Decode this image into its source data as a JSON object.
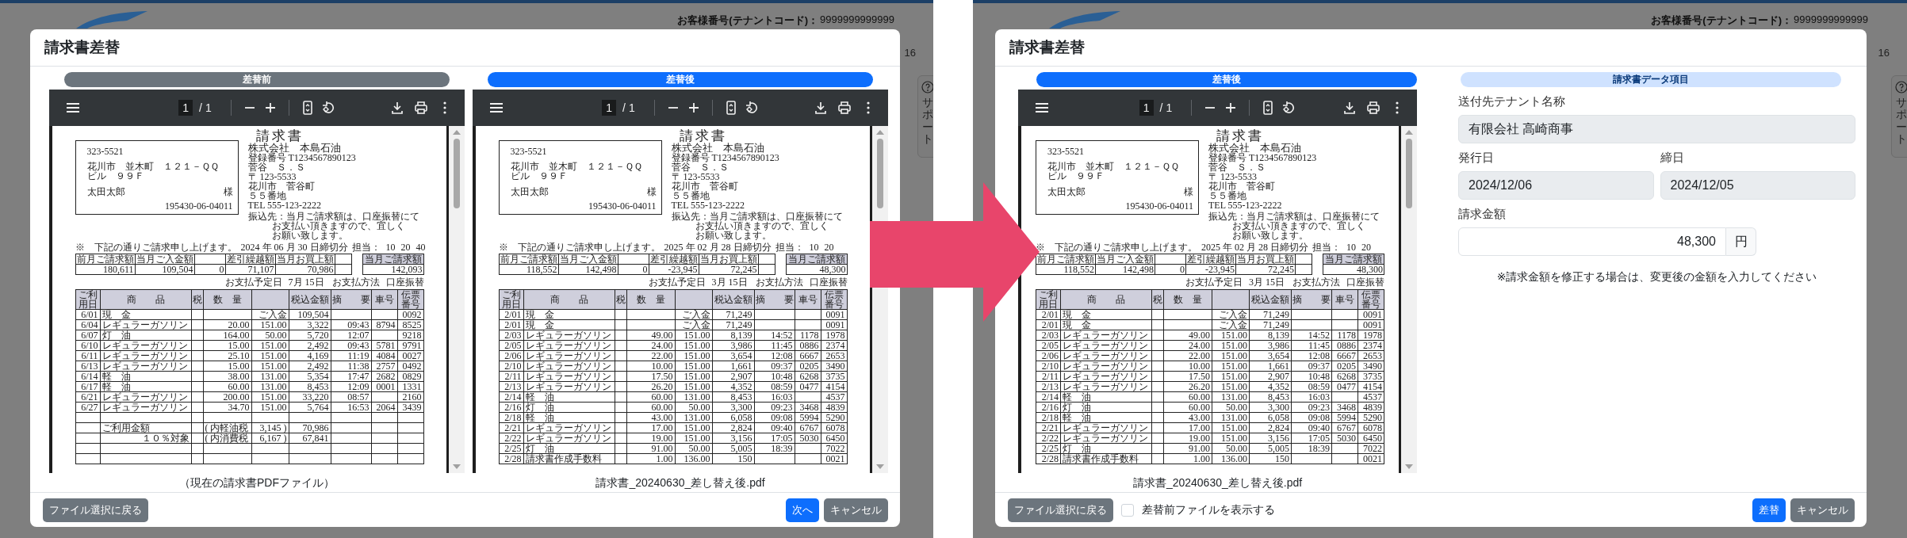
{
  "screens": [
    {
      "backdrop": {
        "customer_label": "お客様番号(テナントコード)：",
        "customer_number": "9999999999999",
        "partial_text": "16",
        "support_tab": "サポート"
      },
      "dialog": {
        "title": "請求書差替",
        "viewers": [
          {
            "heading": "差替前",
            "kind": "before",
            "page": "1",
            "page_total": "/ 1",
            "caption": "（現在の請求書PDFファイル）",
            "document": {
              "address": {
                "postal": "323-5521",
                "lines": [
                  "花川市　並木町　１２１－ＱＱ",
                  "ビル　９９Ｆ"
                ],
                "recipient": "太田太郎",
                "honorific": "様",
                "code": "195430-06-04011"
              },
              "title": "請求書",
              "issuer": {
                "name": "株式会社　本島石油",
                "registration_label": "登録番号",
                "registration": "T1234567890123",
                "lines": [
                  "菅谷　Ｓ．Ｓ",
                  "〒 123-5533",
                  "花川市　菅谷町",
                  "５５番地",
                  "TEL 555-123-2222"
                ]
              },
              "remittance_note": [
                "振込先：当月ご請求額は、口座振替にて",
                "お支払い頂きますので、宜しく",
                "お願い致します。"
              ],
              "lead": "※　下記の通りご請求申し上げます。",
              "closing": "2024 年 06 月 30 日締切分",
              "staff_label": "担当：",
              "staff": [
                "10",
                "20",
                "40"
              ],
              "summary": [
                {
                  "heading": "前月ご請求額",
                  "value": "180,611"
                },
                {
                  "heading": "当月ご入金額",
                  "value": "109,504"
                },
                {
                  "value": "0"
                },
                {
                  "heading": "差引繰越額",
                  "value": "71,107"
                },
                {
                  "heading": "当月お買上額",
                  "value": "70,986"
                }
              ],
              "total": {
                "heading": "当月ご請求額",
                "value": "142,093"
              },
              "payment": {
                "due_label": "お支払予定日",
                "due": "7月 15日",
                "method_label": "お支払方法",
                "method": "口座振替"
              },
              "columns": {
                "date": "ご利用日",
                "product": "商　　品",
                "tax": "税",
                "quantity": "数　量",
                "amount": "税込金額",
                "memo": "摘　　要",
                "car": "車号",
                "slip": "伝票番号"
              },
              "rows": [
                {
                  "kind": "entry",
                  "date": "6/01",
                  "product": "現　金",
                  "price": "ご入金",
                  "amount": "109,504",
                  "slip": "0092"
                },
                {
                  "kind": "entry",
                  "date": "6/04",
                  "product": "レギュラーガソリン",
                  "quantity": "20.00",
                  "price": "151.00",
                  "amount": "3,322",
                  "memo": "09:43",
                  "car": "8794",
                  "slip": "8525"
                },
                {
                  "kind": "entry",
                  "date": "6/07",
                  "product": "灯　油",
                  "quantity": "164.00",
                  "price": "50.00",
                  "amount": "5,720",
                  "memo": "12:07",
                  "slip": "9218"
                },
                {
                  "kind": "entry",
                  "date": "6/10",
                  "product": "レギュラーガソリン",
                  "quantity": "15.00",
                  "price": "151.00",
                  "amount": "2,492",
                  "memo": "09:43",
                  "car": "5781",
                  "slip": "9791"
                },
                {
                  "kind": "entry",
                  "date": "6/11",
                  "product": "レギュラーガソリン",
                  "quantity": "25.10",
                  "price": "151.00",
                  "amount": "4,169",
                  "memo": "11:19",
                  "car": "4084",
                  "slip": "0027"
                },
                {
                  "kind": "entry",
                  "date": "6/13",
                  "product": "レギュラーガソリン",
                  "quantity": "15.00",
                  "price": "151.00",
                  "amount": "2,492",
                  "memo": "11:38",
                  "car": "2757",
                  "slip": "0492"
                },
                {
                  "kind": "entry",
                  "date": "6/14",
                  "product": "軽　油",
                  "quantity": "38.00",
                  "price": "131.00",
                  "amount": "5,354",
                  "memo": "17:47",
                  "car": "2682",
                  "slip": "0829"
                },
                {
                  "kind": "entry",
                  "date": "6/17",
                  "product": "軽　油",
                  "quantity": "60.00",
                  "price": "131.00",
                  "amount": "8,453",
                  "memo": "12:09",
                  "car": "0001",
                  "slip": "1331"
                },
                {
                  "kind": "entry",
                  "date": "6/21",
                  "product": "レギュラーガソリン",
                  "quantity": "200.00",
                  "price": "151.00",
                  "amount": "33,220",
                  "memo": "08:57",
                  "slip": "2160"
                },
                {
                  "kind": "entry",
                  "date": "6/27",
                  "product": "レギュラーガソリン",
                  "quantity": "34.70",
                  "price": "151.00",
                  "amount": "5,764",
                  "memo": "16:53",
                  "car": "2064",
                  "slip": "3439"
                },
                {
                  "kind": "blank"
                },
                {
                  "kind": "usage-total",
                  "product": "ご利用金額",
                  "quantity": "( 内軽油税",
                  "price": "3,145 )",
                  "amount": "70,986"
                },
                {
                  "kind": "tax-band",
                  "product": "１０％対象",
                  "quantity": "( 内消費税",
                  "price": "6,167 )",
                  "amount": "67,841"
                },
                {
                  "kind": "blank"
                },
                {
                  "kind": "blank"
                }
              ]
            }
          },
          {
            "heading": "差替後",
            "kind": "after",
            "page": "1",
            "page_total": "/ 1",
            "caption": "請求書_20240630_差し替え後.pdf",
            "document": {
              "address": {
                "postal": "323-5521",
                "lines": [
                  "花川市　並木町　１２１－ＱＱ",
                  "ビル　９９Ｆ"
                ],
                "recipient": "太田太郎",
                "honorific": "様",
                "code": "195430-06-04011"
              },
              "title": "請求書",
              "issuer": {
                "name": "株式会社　本島石油",
                "registration_label": "登録番号",
                "registration": "T1234567890123",
                "lines": [
                  "菅谷　Ｓ．Ｓ",
                  "〒 123-5533",
                  "花川市　菅谷町",
                  "５５番地",
                  "TEL 555-123-2222"
                ]
              },
              "remittance_note": [
                "振込先：当月ご請求額は、口座振替にて",
                "お支払い頂きますので、宜しく",
                "お願い致します。"
              ],
              "lead": "※　下記の通りご請求申し上げます。",
              "closing": "2025 年 02 月 28 日締切分",
              "staff_label": "担当：",
              "staff": [
                "10",
                "20"
              ],
              "summary": [
                {
                  "heading": "前月ご請求額",
                  "value": "118,552"
                },
                {
                  "heading": "当月ご入金額",
                  "value": "142,498"
                },
                {
                  "value": "0"
                },
                {
                  "heading": "差引繰越額",
                  "value": "-23,945"
                },
                {
                  "heading": "当月お買上額",
                  "value": "72,245"
                }
              ],
              "total": {
                "heading": "当月ご請求額",
                "value": "48,300"
              },
              "payment": {
                "due_label": "お支払予定日",
                "due": "3月 15日",
                "method_label": "お支払方法",
                "method": "口座振替"
              },
              "columns": {
                "date": "ご利用日",
                "product": "商　　品",
                "tax": "税",
                "quantity": "数　量",
                "amount": "税込金額",
                "memo": "摘　　要",
                "car": "車号",
                "slip": "伝票番号"
              },
              "rows": [
                {
                  "kind": "entry",
                  "date": "2/01",
                  "product": "現　金",
                  "price": "ご入金",
                  "amount": "71,249",
                  "slip": "0091"
                },
                {
                  "kind": "entry",
                  "date": "2/01",
                  "product": "現　金",
                  "price": "ご入金",
                  "amount": "71,249",
                  "slip": "0091"
                },
                {
                  "kind": "entry",
                  "date": "2/03",
                  "product": "レギュラーガソリン",
                  "quantity": "49.00",
                  "price": "151.00",
                  "amount": "8,139",
                  "memo": "14:52",
                  "car": "1178",
                  "slip": "1978"
                },
                {
                  "kind": "entry",
                  "date": "2/05",
                  "product": "レギュラーガソリン",
                  "quantity": "24.00",
                  "price": "151.00",
                  "amount": "3,986",
                  "memo": "11:45",
                  "car": "0886",
                  "slip": "2374"
                },
                {
                  "kind": "entry",
                  "date": "2/06",
                  "product": "レギュラーガソリン",
                  "quantity": "22.00",
                  "price": "151.00",
                  "amount": "3,654",
                  "memo": "12:08",
                  "car": "6667",
                  "slip": "2653"
                },
                {
                  "kind": "entry",
                  "date": "2/10",
                  "product": "レギュラーガソリン",
                  "quantity": "10.00",
                  "price": "151.00",
                  "amount": "1,661",
                  "memo": "09:37",
                  "car": "0205",
                  "slip": "3490"
                },
                {
                  "kind": "entry",
                  "date": "2/11",
                  "product": "レギュラーガソリン",
                  "quantity": "17.50",
                  "price": "151.00",
                  "amount": "2,907",
                  "memo": "10:48",
                  "car": "6268",
                  "slip": "3735"
                },
                {
                  "kind": "entry",
                  "date": "2/13",
                  "product": "レギュラーガソリン",
                  "quantity": "26.20",
                  "price": "151.00",
                  "amount": "4,352",
                  "memo": "08:59",
                  "car": "0477",
                  "slip": "4154"
                },
                {
                  "kind": "entry",
                  "date": "2/14",
                  "product": "軽　油",
                  "quantity": "60.00",
                  "price": "131.00",
                  "amount": "8,453",
                  "memo": "16:03",
                  "slip": "4537"
                },
                {
                  "kind": "entry",
                  "date": "2/16",
                  "product": "灯　油",
                  "quantity": "60.00",
                  "price": "50.00",
                  "amount": "3,300",
                  "memo": "09:23",
                  "car": "3468",
                  "slip": "4839"
                },
                {
                  "kind": "entry",
                  "date": "2/18",
                  "product": "軽　油",
                  "quantity": "43.00",
                  "price": "131.00",
                  "amount": "6,058",
                  "memo": "09:08",
                  "car": "5994",
                  "slip": "5290"
                },
                {
                  "kind": "entry",
                  "date": "2/21",
                  "product": "レギュラーガソリン",
                  "quantity": "17.00",
                  "price": "151.00",
                  "amount": "2,824",
                  "memo": "09:40",
                  "car": "6767",
                  "slip": "6078"
                },
                {
                  "kind": "entry",
                  "date": "2/22",
                  "product": "レギュラーガソリン",
                  "quantity": "19.00",
                  "price": "151.00",
                  "amount": "3,156",
                  "memo": "17:05",
                  "car": "5030",
                  "slip": "6450"
                },
                {
                  "kind": "entry",
                  "date": "2/25",
                  "product": "灯　油",
                  "quantity": "91.00",
                  "price": "50.00",
                  "amount": "5,005",
                  "memo": "18:39",
                  "slip": "7022"
                },
                {
                  "kind": "entry",
                  "date": "2/28",
                  "product": "請求書作成手数料",
                  "quantity": "1.00",
                  "price": "136.00",
                  "amount": "150",
                  "slip": "0021"
                }
              ]
            }
          }
        ],
        "footer": {
          "back": "ファイル選択に戻る",
          "buttons": [
            {
              "label": "次へ",
              "kind": "primary"
            },
            {
              "label": "キャンセル",
              "kind": "secondary"
            }
          ]
        }
      }
    },
    {
      "backdrop": {
        "customer_label": "お客様番号(テナントコード)：",
        "customer_number": "9999999999999",
        "partial_text": "16",
        "support_tab": "サポート"
      },
      "dialog": {
        "title": "請求書差替",
        "viewers": [
          {
            "heading": "差替後",
            "kind": "after",
            "page": "1",
            "page_total": "/ 1",
            "caption": "請求書_20240630_差し替え後.pdf",
            "document": {
              "address": {
                "postal": "323-5521",
                "lines": [
                  "花川市　並木町　１２１－ＱＱ",
                  "ビル　９９Ｆ"
                ],
                "recipient": "太田太郎",
                "honorific": "様",
                "code": "195430-06-04011"
              },
              "title": "請求書",
              "issuer": {
                "name": "株式会社　本島石油",
                "registration_label": "登録番号",
                "registration": "T1234567890123",
                "lines": [
                  "菅谷　Ｓ．Ｓ",
                  "〒 123-5533",
                  "花川市　菅谷町",
                  "５５番地",
                  "TEL 555-123-2222"
                ]
              },
              "remittance_note": [
                "振込先：当月ご請求額は、口座振替にて",
                "お支払い頂きますので、宜しく",
                "お願い致します。"
              ],
              "lead": "※　下記の通りご請求申し上げます。",
              "closing": "2025 年 02 月 28 日締切分",
              "staff_label": "担当：",
              "staff": [
                "10",
                "20"
              ],
              "summary": [
                {
                  "heading": "前月ご請求額",
                  "value": "118,552"
                },
                {
                  "heading": "当月ご入金額",
                  "value": "142,498"
                },
                {
                  "value": "0"
                },
                {
                  "heading": "差引繰越額",
                  "value": "-23,945"
                },
                {
                  "heading": "当月お買上額",
                  "value": "72,245"
                }
              ],
              "total": {
                "heading": "当月ご請求額",
                "value": "48,300"
              },
              "payment": {
                "due_label": "お支払予定日",
                "due": "3月 15日",
                "method_label": "お支払方法",
                "method": "口座振替"
              },
              "columns": {
                "date": "ご利用日",
                "product": "商　　品",
                "tax": "税",
                "quantity": "数　量",
                "amount": "税込金額",
                "memo": "摘　　要",
                "car": "車号",
                "slip": "伝票番号"
              },
              "rows": [
                {
                  "kind": "entry",
                  "date": "2/01",
                  "product": "現　金",
                  "price": "ご入金",
                  "amount": "71,249",
                  "slip": "0091"
                },
                {
                  "kind": "entry",
                  "date": "2/01",
                  "product": "現　金",
                  "price": "ご入金",
                  "amount": "71,249",
                  "slip": "0091"
                },
                {
                  "kind": "entry",
                  "date": "2/03",
                  "product": "レギュラーガソリン",
                  "quantity": "49.00",
                  "price": "151.00",
                  "amount": "8,139",
                  "memo": "14:52",
                  "car": "1178",
                  "slip": "1978"
                },
                {
                  "kind": "entry",
                  "date": "2/05",
                  "product": "レギュラーガソリン",
                  "quantity": "24.00",
                  "price": "151.00",
                  "amount": "3,986",
                  "memo": "11:45",
                  "car": "0886",
                  "slip": "2374"
                },
                {
                  "kind": "entry",
                  "date": "2/06",
                  "product": "レギュラーガソリン",
                  "quantity": "22.00",
                  "price": "151.00",
                  "amount": "3,654",
                  "memo": "12:08",
                  "car": "6667",
                  "slip": "2653"
                },
                {
                  "kind": "entry",
                  "date": "2/10",
                  "product": "レギュラーガソリン",
                  "quantity": "10.00",
                  "price": "151.00",
                  "amount": "1,661",
                  "memo": "09:37",
                  "car": "0205",
                  "slip": "3490"
                },
                {
                  "kind": "entry",
                  "date": "2/11",
                  "product": "レギュラーガソリン",
                  "quantity": "17.50",
                  "price": "151.00",
                  "amount": "2,907",
                  "memo": "10:48",
                  "car": "6268",
                  "slip": "3735"
                },
                {
                  "kind": "entry",
                  "date": "2/13",
                  "product": "レギュラーガソリン",
                  "quantity": "26.20",
                  "price": "151.00",
                  "amount": "4,352",
                  "memo": "08:59",
                  "car": "0477",
                  "slip": "4154"
                },
                {
                  "kind": "entry",
                  "date": "2/14",
                  "product": "軽　油",
                  "quantity": "60.00",
                  "price": "131.00",
                  "amount": "8,453",
                  "memo": "16:03",
                  "slip": "4537"
                },
                {
                  "kind": "entry",
                  "date": "2/16",
                  "product": "灯　油",
                  "quantity": "60.00",
                  "price": "50.00",
                  "amount": "3,300",
                  "memo": "09:23",
                  "car": "3468",
                  "slip": "4839"
                },
                {
                  "kind": "entry",
                  "date": "2/18",
                  "product": "軽　油",
                  "quantity": "43.00",
                  "price": "131.00",
                  "amount": "6,058",
                  "memo": "09:08",
                  "car": "5994",
                  "slip": "5290"
                },
                {
                  "kind": "entry",
                  "date": "2/21",
                  "product": "レギュラーガソリン",
                  "quantity": "17.00",
                  "price": "151.00",
                  "amount": "2,824",
                  "memo": "09:40",
                  "car": "6767",
                  "slip": "6078"
                },
                {
                  "kind": "entry",
                  "date": "2/22",
                  "product": "レギュラーガソリン",
                  "quantity": "19.00",
                  "price": "151.00",
                  "amount": "3,156",
                  "memo": "17:05",
                  "car": "5030",
                  "slip": "6450"
                },
                {
                  "kind": "entry",
                  "date": "2/25",
                  "product": "灯　油",
                  "quantity": "91.00",
                  "price": "50.00",
                  "amount": "5,005",
                  "memo": "18:39",
                  "slip": "7022"
                },
                {
                  "kind": "entry",
                  "date": "2/28",
                  "product": "請求書作成手数料",
                  "quantity": "1.00",
                  "price": "136.00",
                  "amount": "150",
                  "slip": "0021"
                }
              ]
            }
          }
        ],
        "form": {
          "heading": "請求書データ項目",
          "tenant": {
            "label": "送付先テナント名称",
            "value": "有限会社 高崎商事",
            "readonly": true
          },
          "issue_date": {
            "label": "発行日",
            "value": "2024/12/06",
            "readonly": true
          },
          "closing_date": {
            "label": "締日",
            "value": "2024/12/05",
            "readonly": true
          },
          "amount": {
            "label": "請求金額",
            "value": "48,300",
            "unit": "円",
            "readonly": false
          },
          "note": "※請求金額を修正する場合は、変更後の金額を入力してください"
        },
        "footer": {
          "back": "ファイル選択に戻る",
          "checkbox": {
            "label": "差替前ファイルを表示する",
            "checked": false
          },
          "buttons": [
            {
              "label": "差替",
              "kind": "primary"
            },
            {
              "label": "キャンセル",
              "kind": "secondary"
            }
          ]
        }
      }
    }
  ]
}
